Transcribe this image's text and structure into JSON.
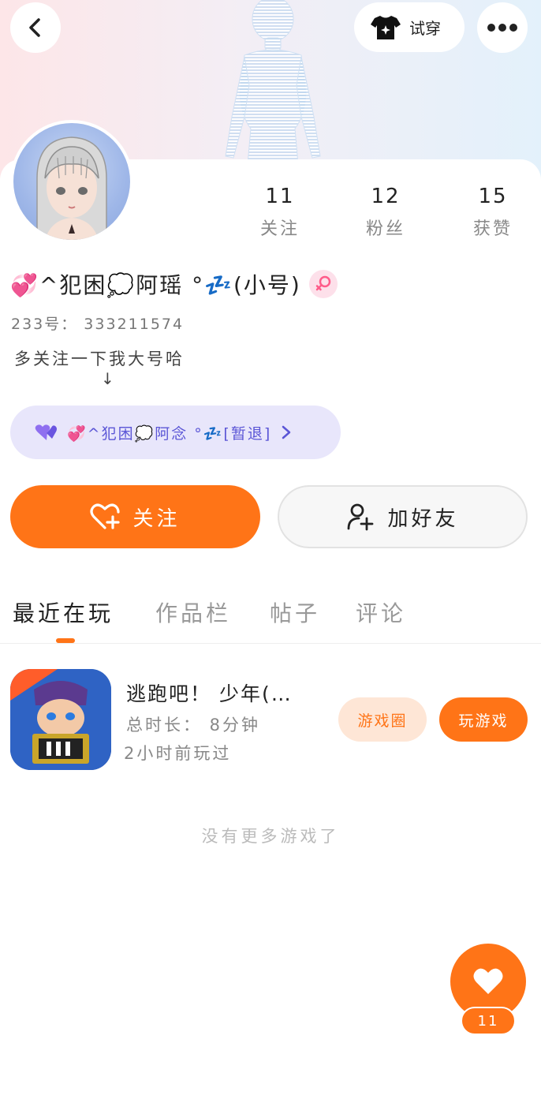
{
  "header": {
    "tryon_label": "试穿",
    "back_icon": "chevron-left-icon",
    "more_icon": "more-dots-icon"
  },
  "profile": {
    "name": "💞^犯困💭阿瑶 °💤(小号)",
    "gender": "female",
    "account_no": "233号：  333211574",
    "bio_line1": "多关注一下我大号哈",
    "bio_line2": "↓",
    "linked_account": "💞^犯困💭阿念 °💤[暂退]"
  },
  "stats": [
    {
      "value": "11",
      "label": "关注"
    },
    {
      "value": "12",
      "label": "粉丝"
    },
    {
      "value": "15",
      "label": "获赞"
    }
  ],
  "actions": {
    "follow_label": "关注",
    "add_friend_label": "加好友"
  },
  "tabs": [
    {
      "label": "最近在玩",
      "active": true
    },
    {
      "label": "作品栏",
      "active": false
    },
    {
      "label": "帖子",
      "active": false
    },
    {
      "label": "评论",
      "active": false
    }
  ],
  "games": [
    {
      "title": "逃跑吧！ 少年(…",
      "total_time": "总时长：  8分钟",
      "last_played": "2小时前玩过",
      "circle_label": "游戏圈",
      "play_label": "玩游戏"
    }
  ],
  "empty_hint": "没有更多游戏了",
  "like_fab": {
    "count": "11"
  },
  "colors": {
    "accent": "#ff7417",
    "accent_light": "#fee6d6",
    "linked_bg": "#e8e6fb",
    "linked_text": "#5b56d6"
  }
}
